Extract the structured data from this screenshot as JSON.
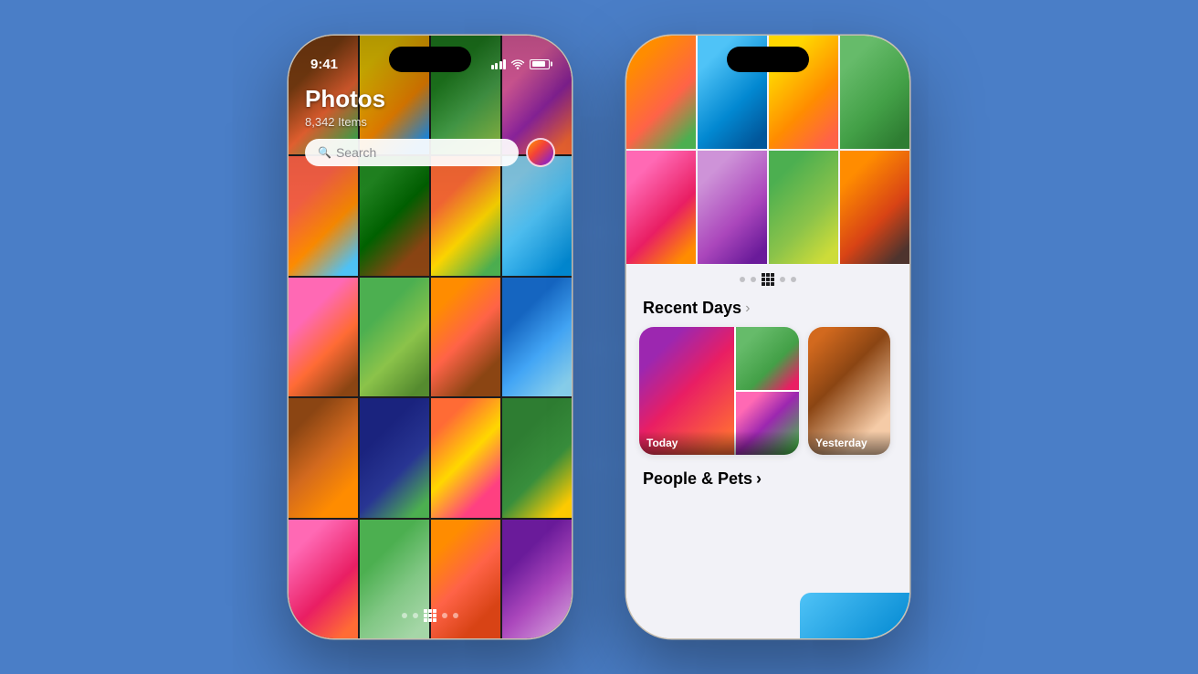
{
  "background": {
    "color": "#4a7ec7"
  },
  "left_phone": {
    "status_bar": {
      "time": "9:41",
      "signal": "●●●●",
      "wifi": "wifi",
      "battery": "battery"
    },
    "header": {
      "title": "Photos",
      "count": "8,342 Items",
      "search_placeholder": "Search",
      "search_label": "Search"
    },
    "page_indicator": {
      "dots": [
        "dot",
        "dot",
        "grid-active",
        "dot",
        "dot"
      ]
    }
  },
  "right_phone": {
    "sections": {
      "recent_days": {
        "title": "Recent Days",
        "chevron": ">",
        "cards": [
          {
            "label": "Today"
          },
          {
            "label": "Yesterday"
          }
        ]
      },
      "people_pets": {
        "title": "People & Pets",
        "chevron": ">"
      }
    },
    "page_indicator": {
      "dots": [
        "dot",
        "dot",
        "grid-active",
        "dot",
        "dot"
      ]
    }
  }
}
